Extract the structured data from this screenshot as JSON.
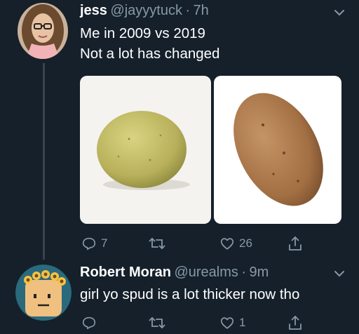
{
  "tweet": {
    "name": "jess",
    "handle": "@jayyytuck",
    "separator": "·",
    "time": "7h",
    "text_line1": "Me in 2009 vs 2019",
    "text_line2": "Not a lot has changed",
    "images": [
      "small round yellow potato",
      "large russet potato"
    ],
    "actions": {
      "reply_count": "7",
      "retweet_count": "",
      "like_count": "26"
    }
  },
  "reply": {
    "name": "Robert Moran",
    "handle": "@urealms",
    "separator": "·",
    "time": "9m",
    "text": "girl yo spud is a lot thicker now tho",
    "actions": {
      "reply_count": "",
      "retweet_count": "",
      "like_count": "1"
    }
  },
  "colors": {
    "background": "#15202b",
    "muted": "#8899a6",
    "divider": "#38444d"
  },
  "icons": [
    "reply-icon",
    "retweet-icon",
    "like-icon",
    "share-icon",
    "chevron-down-icon"
  ]
}
